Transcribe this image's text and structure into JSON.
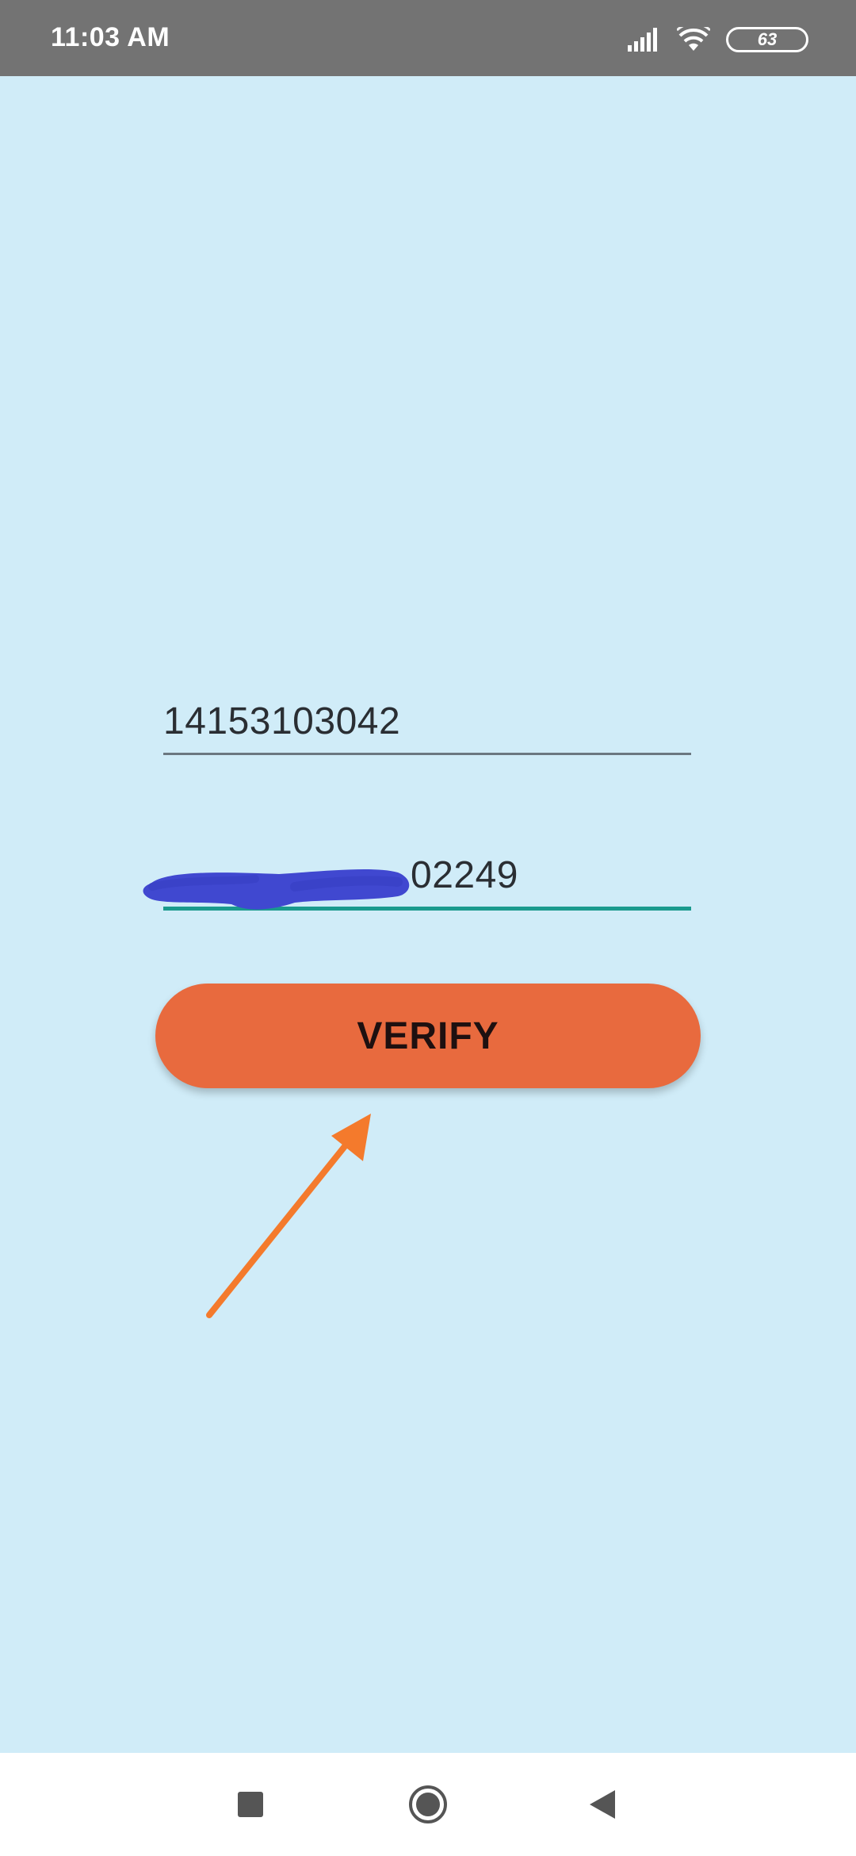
{
  "status_bar": {
    "time": "11:03 AM",
    "battery_level": "63",
    "icons": [
      "signal-icon",
      "wifi-icon",
      "battery-icon"
    ]
  },
  "form": {
    "phone_number": "14153103042",
    "verification_code_visible": "02249",
    "verify_button_label": "VERIFY"
  },
  "nav_bar": {
    "buttons": [
      "recents-icon",
      "home-icon",
      "back-icon"
    ]
  },
  "colors": {
    "background": "#d0ecf8",
    "status_bar": "#737373",
    "button": "#e86a3e",
    "active_underline": "#1a9a8e",
    "redaction": "#4048d0",
    "annotation_arrow": "#f47a2c"
  }
}
